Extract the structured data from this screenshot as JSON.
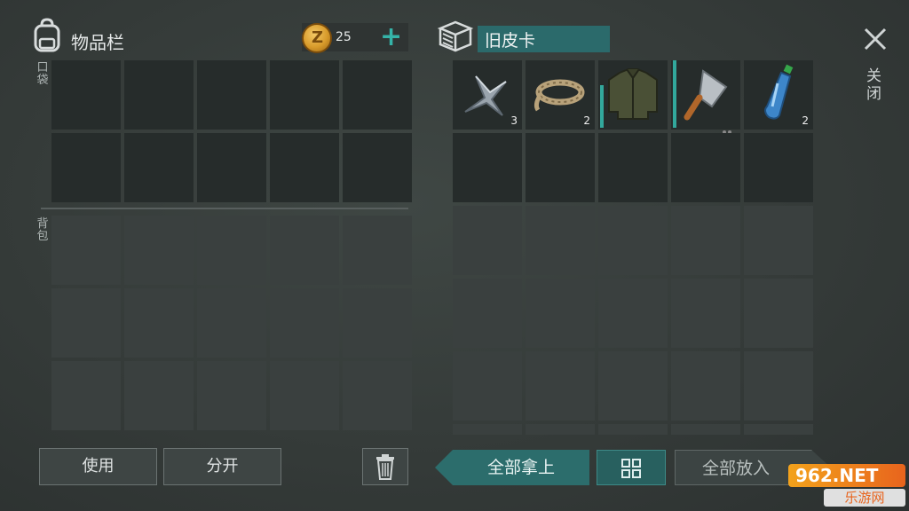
{
  "inventory": {
    "title": "物品栏",
    "pocket_label": "口袋",
    "backpack_label": "背包",
    "coin_count": "25",
    "coin_plus": "+",
    "coin_symbol": "Z"
  },
  "container": {
    "name": "旧皮卡",
    "items": [
      {
        "name": "shuriken-icon",
        "count": "3"
      },
      {
        "name": "rope-icon",
        "count": "2"
      },
      {
        "name": "jacket-icon",
        "count": ""
      },
      {
        "name": "cleaver-icon",
        "count": ""
      },
      {
        "name": "water-bottle-icon",
        "count": "2"
      }
    ]
  },
  "close": {
    "glyph": "✕",
    "label": "关闭"
  },
  "buttons": {
    "use": "使用",
    "split": "分开",
    "take_all": "全部拿上",
    "put_all": "全部放入"
  },
  "watermark": {
    "top": "962.NET",
    "bottom": "乐游网"
  },
  "colors": {
    "accent": "#35b3a8",
    "selected": "#2b6a6b"
  }
}
